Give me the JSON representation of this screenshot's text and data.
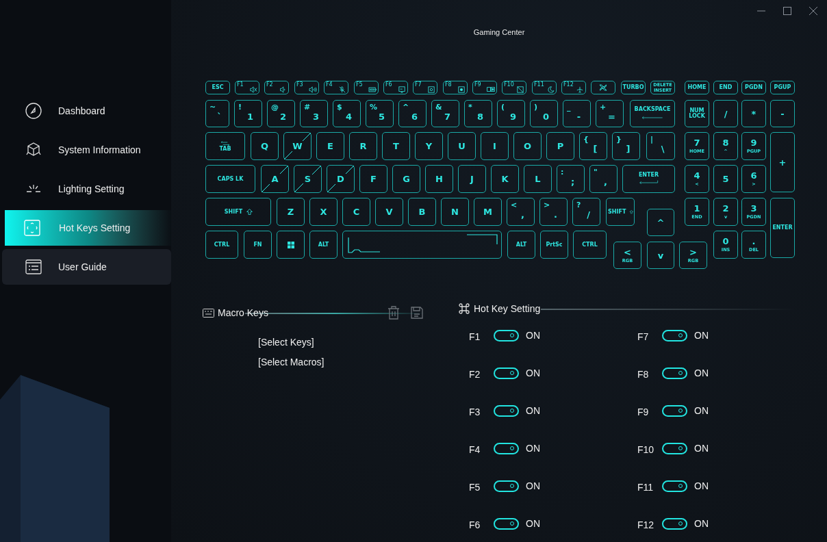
{
  "window": {
    "title": "Gaming Center"
  },
  "sidebar": {
    "items": [
      {
        "label": "Dashboard",
        "selected": false,
        "hovered": false
      },
      {
        "label": "System Information",
        "selected": false,
        "hovered": false
      },
      {
        "label": "Lighting Setting",
        "selected": false,
        "hovered": false
      },
      {
        "label": "Hot Keys Setting",
        "selected": true,
        "hovered": false
      },
      {
        "label": "User Guide",
        "selected": false,
        "hovered": true
      }
    ]
  },
  "keyboard": {
    "keys": [
      {
        "label": "ESC",
        "crossed": false
      },
      {
        "label": "F1",
        "crossed": false
      },
      {
        "label": "F2",
        "crossed": false
      },
      {
        "label": "F3",
        "crossed": false
      },
      {
        "label": "F4",
        "crossed": false
      },
      {
        "label": "F5",
        "crossed": false
      },
      {
        "label": "F6",
        "crossed": false
      },
      {
        "label": "F7",
        "crossed": false
      },
      {
        "label": "F8",
        "crossed": false
      },
      {
        "label": "F9",
        "crossed": false
      },
      {
        "label": "F10",
        "crossed": false
      },
      {
        "label": "F11",
        "crossed": false
      },
      {
        "label": "F12",
        "crossed": false
      },
      {
        "crossed": false
      },
      {
        "label": "TURBO",
        "crossed": false
      },
      {
        "label": "DELETE",
        "sub": "INSERT",
        "crossed": false
      },
      {
        "label": "HOME",
        "crossed": false
      },
      {
        "label": "END",
        "crossed": false
      },
      {
        "label": "PGDN",
        "crossed": false
      },
      {
        "label": "PGUP",
        "crossed": false
      },
      {
        "label": "`",
        "top": "~",
        "crossed": false
      },
      {
        "label": "1",
        "top": "!",
        "crossed": false
      },
      {
        "label": "2",
        "top": "@",
        "crossed": false
      },
      {
        "label": "3",
        "top": "#",
        "crossed": false
      },
      {
        "label": "4",
        "top": "$",
        "crossed": false
      },
      {
        "label": "5",
        "top": "%",
        "crossed": false
      },
      {
        "label": "6",
        "top": "^",
        "crossed": false
      },
      {
        "label": "7",
        "top": "&",
        "crossed": false
      },
      {
        "label": "8",
        "top": "*",
        "crossed": false
      },
      {
        "label": "9",
        "top": "(",
        "crossed": false
      },
      {
        "label": "0",
        "top": ")",
        "crossed": false
      },
      {
        "label": "-",
        "top": "_",
        "crossed": false
      },
      {
        "label": "=",
        "top": "+",
        "crossed": false
      },
      {
        "label": "BACKSPACE",
        "crossed": false
      },
      {
        "label": "NUM LOCK",
        "crossed": false
      },
      {
        "label": "/",
        "crossed": false
      },
      {
        "label": "*",
        "crossed": false
      },
      {
        "label": "-",
        "crossed": false
      },
      {
        "label": "TAB",
        "crossed": false
      },
      {
        "label": "Q",
        "crossed": false
      },
      {
        "label": "W",
        "crossed": true
      },
      {
        "label": "E",
        "crossed": false
      },
      {
        "label": "R",
        "crossed": false
      },
      {
        "label": "T",
        "crossed": false
      },
      {
        "label": "Y",
        "crossed": false
      },
      {
        "label": "U",
        "crossed": false
      },
      {
        "label": "I",
        "crossed": false
      },
      {
        "label": "O",
        "crossed": false
      },
      {
        "label": "P",
        "crossed": false
      },
      {
        "label": "[",
        "top": "{",
        "crossed": false
      },
      {
        "label": "]",
        "top": "}",
        "crossed": false
      },
      {
        "label": "\\",
        "top": "|",
        "crossed": false
      },
      {
        "label": "7",
        "sub": "HOME",
        "crossed": false
      },
      {
        "label": "8",
        "sub": "^",
        "crossed": false
      },
      {
        "label": "9",
        "sub": "PGUP",
        "crossed": false
      },
      {
        "label": "+",
        "crossed": false
      },
      {
        "label": "CAPS LK",
        "crossed": false
      },
      {
        "label": "A",
        "crossed": true
      },
      {
        "label": "S",
        "crossed": true
      },
      {
        "label": "D",
        "crossed": true
      },
      {
        "label": "F",
        "crossed": false
      },
      {
        "label": "G",
        "crossed": false
      },
      {
        "label": "H",
        "crossed": false
      },
      {
        "label": "J",
        "crossed": false
      },
      {
        "label": "K",
        "crossed": false
      },
      {
        "label": "L",
        "crossed": false
      },
      {
        "label": ";",
        "top": ":",
        "crossed": false
      },
      {
        "label": ",",
        "top": "\"",
        "crossed": false
      },
      {
        "label": "ENTER",
        "crossed": false
      },
      {
        "label": "4",
        "sub": "<",
        "crossed": false
      },
      {
        "label": "5",
        "crossed": false
      },
      {
        "label": "6",
        "sub": ">",
        "crossed": false
      },
      {
        "label": "SHIFT",
        "crossed": false
      },
      {
        "label": "Z",
        "crossed": false
      },
      {
        "label": "X",
        "crossed": false
      },
      {
        "label": "C",
        "crossed": false
      },
      {
        "label": "V",
        "crossed": false
      },
      {
        "label": "B",
        "crossed": false
      },
      {
        "label": "N",
        "crossed": false
      },
      {
        "label": "M",
        "crossed": false
      },
      {
        "label": ",",
        "top": "<",
        "crossed": false
      },
      {
        "label": ".",
        "top": ">",
        "crossed": false
      },
      {
        "label": "/",
        "top": "?",
        "crossed": false
      },
      {
        "label": "SHIFT",
        "crossed": false
      },
      {
        "label": "^",
        "crossed": false
      },
      {
        "label": "1",
        "sub": "END",
        "crossed": false
      },
      {
        "label": "2",
        "sub": "v",
        "crossed": false
      },
      {
        "label": "3",
        "sub": "PGDN",
        "crossed": false
      },
      {
        "label": "ENTER",
        "crossed": false
      },
      {
        "label": "CTRL",
        "crossed": false
      },
      {
        "label": "FN",
        "crossed": false
      },
      {
        "crossed": false
      },
      {
        "label": "ALT",
        "crossed": false
      },
      {
        "crossed": false
      },
      {
        "label": "ALT",
        "crossed": false
      },
      {
        "label": "PrtSc",
        "crossed": false
      },
      {
        "label": "CTRL",
        "crossed": false
      },
      {
        "label": "<",
        "sub": "RGB",
        "crossed": false
      },
      {
        "label": "v",
        "crossed": false
      },
      {
        "label": ">",
        "sub": "RGB",
        "crossed": false
      },
      {
        "label": "0",
        "sub": "INS",
        "crossed": false
      },
      {
        "label": ".",
        "sub": "DEL",
        "crossed": false
      }
    ]
  },
  "macro_keys": {
    "title": "Macro Keys",
    "fields": [
      "[Select Keys]",
      "[Select Macros]"
    ]
  },
  "hot_key_setting": {
    "title": "Hot Key Setting",
    "columns": [
      [
        {
          "key": "F1",
          "on": true,
          "status": "ON"
        },
        {
          "key": "F2",
          "on": true,
          "status": "ON"
        },
        {
          "key": "F3",
          "on": true,
          "status": "ON"
        },
        {
          "key": "F4",
          "on": true,
          "status": "ON"
        },
        {
          "key": "F5",
          "on": true,
          "status": "ON"
        },
        {
          "key": "F6",
          "on": true,
          "status": "ON"
        }
      ],
      [
        {
          "key": "F7",
          "on": true,
          "status": "ON"
        },
        {
          "key": "F8",
          "on": true,
          "status": "ON"
        },
        {
          "key": "F9",
          "on": true,
          "status": "ON"
        },
        {
          "key": "F10",
          "on": true,
          "status": "ON"
        },
        {
          "key": "F11",
          "on": true,
          "status": "ON"
        },
        {
          "key": "F12",
          "on": true,
          "status": "ON"
        }
      ]
    ]
  }
}
